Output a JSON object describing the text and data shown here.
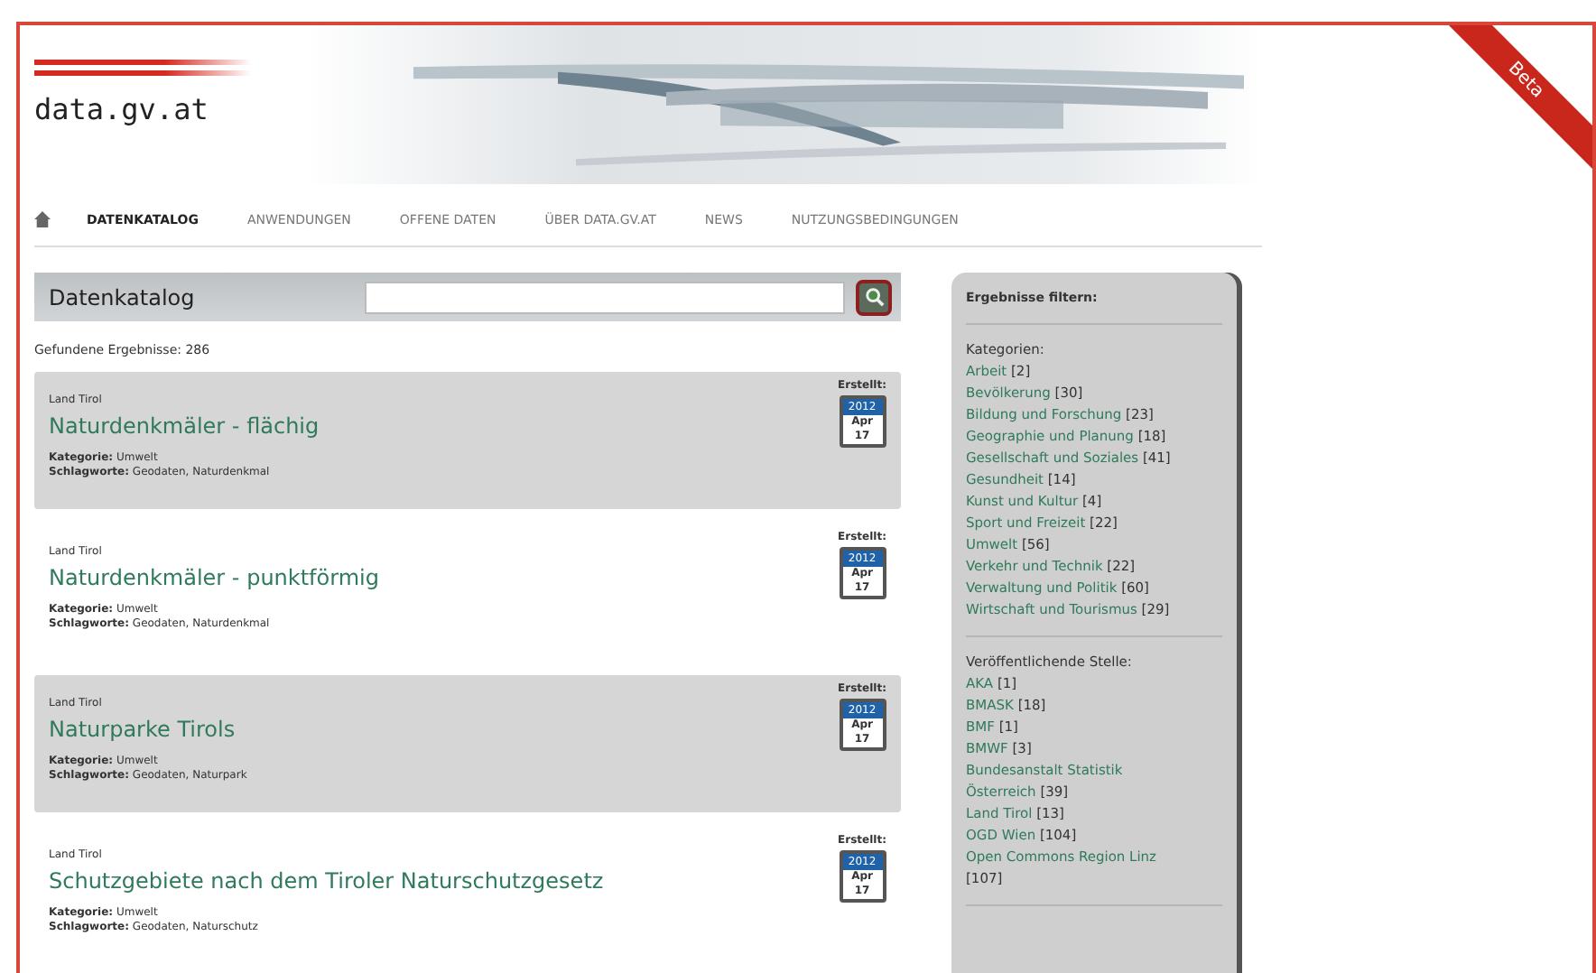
{
  "logo": "data.gv.at",
  "ribbon": "Beta",
  "nav": [
    {
      "label": "DATENKATALOG",
      "selected": true
    },
    {
      "label": "ANWENDUNGEN",
      "selected": false
    },
    {
      "label": "OFFENE DATEN",
      "selected": false
    },
    {
      "label": "ÜBER DATA.GV.AT",
      "selected": false
    },
    {
      "label": "NEWS",
      "selected": false
    },
    {
      "label": "NUTZUNGSBEDINGUNGEN",
      "selected": false
    }
  ],
  "catalog": {
    "title": "Datenkatalog",
    "result_count": "Gefundene Ergebnisse: 286"
  },
  "results": [
    {
      "publisher": "Land Tirol",
      "title": "Naturdenkmäler - flächig",
      "category_label": "Kategorie:",
      "category": "Umwelt",
      "keywords_label": "Schlagworte:",
      "keywords": "Geodaten, Naturdenkmal",
      "created_label": "Erstellt:",
      "year": "2012",
      "month": "Apr",
      "day": "17"
    },
    {
      "publisher": "Land Tirol",
      "title": "Naturdenkmäler - punktförmig",
      "category_label": "Kategorie:",
      "category": "Umwelt",
      "keywords_label": "Schlagworte:",
      "keywords": "Geodaten, Naturdenkmal",
      "created_label": "Erstellt:",
      "year": "2012",
      "month": "Apr",
      "day": "17"
    },
    {
      "publisher": "Land Tirol",
      "title": "Naturparke Tirols",
      "category_label": "Kategorie:",
      "category": "Umwelt",
      "keywords_label": "Schlagworte:",
      "keywords": "Geodaten, Naturpark",
      "created_label": "Erstellt:",
      "year": "2012",
      "month": "Apr",
      "day": "17"
    },
    {
      "publisher": "Land Tirol",
      "title": "Schutzgebiete nach dem Tiroler Naturschutzgesetz",
      "category_label": "Kategorie:",
      "category": "Umwelt",
      "keywords_label": "Schlagworte:",
      "keywords": "Geodaten, Naturschutz",
      "created_label": "Erstellt:",
      "year": "2012",
      "month": "Apr",
      "day": "17"
    }
  ],
  "filters": {
    "title": "Ergebnisse filtern:",
    "groups": [
      {
        "heading": "Kategorien:",
        "items": [
          {
            "name": "Arbeit",
            "count": "[2]"
          },
          {
            "name": "Bevölkerung",
            "count": "[30]"
          },
          {
            "name": "Bildung und Forschung",
            "count": "[23]"
          },
          {
            "name": "Geographie und Planung",
            "count": "[18]"
          },
          {
            "name": "Gesellschaft und Soziales",
            "count": "[41]"
          },
          {
            "name": "Gesundheit",
            "count": "[14]"
          },
          {
            "name": "Kunst und Kultur",
            "count": "[4]"
          },
          {
            "name": "Sport und Freizeit",
            "count": "[22]"
          },
          {
            "name": "Umwelt",
            "count": "[56]"
          },
          {
            "name": "Verkehr und Technik",
            "count": "[22]"
          },
          {
            "name": "Verwaltung und Politik",
            "count": "[60]"
          },
          {
            "name": "Wirtschaft und Tourismus",
            "count": "[29]"
          }
        ]
      },
      {
        "heading": "Veröffentlichende Stelle:",
        "items": [
          {
            "name": "AKA",
            "count": "[1]"
          },
          {
            "name": "BMASK",
            "count": "[18]"
          },
          {
            "name": "BMF",
            "count": "[1]"
          },
          {
            "name": "BMWF",
            "count": "[3]"
          },
          {
            "name": "Bundesanstalt Statistik Österreich",
            "count": "[39]"
          },
          {
            "name": "Land Tirol",
            "count": "[13]"
          },
          {
            "name": "OGD Wien",
            "count": "[104]"
          },
          {
            "name": "Open Commons Region Linz",
            "count": "[107]"
          }
        ]
      }
    ]
  }
}
